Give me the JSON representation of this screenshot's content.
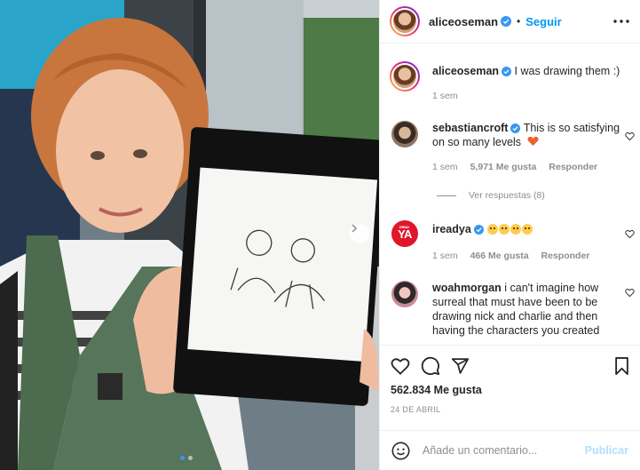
{
  "header": {
    "username": "aliceoseman",
    "separator": "•",
    "follow_label": "Seguir",
    "more_icon": "more-horizontal-icon"
  },
  "caption": {
    "username": "aliceoseman",
    "text": "I was drawing them :)",
    "time": "1 sem"
  },
  "comments": [
    {
      "username": "sebastiancroft",
      "text": "This is so satisfying on so many levels",
      "emoji": "heart-emoji",
      "time": "1 sem",
      "likes": "5,971 Me gusta",
      "reply_label": "Responder",
      "view_replies": "Ver respuestas (8)"
    },
    {
      "username": "ireadya",
      "avatar_text": "YA",
      "avatar_small_text": "I READ",
      "emojis": [
        "loudly-crying-face",
        "pleading-face",
        "pleading-face",
        "pleading-face"
      ],
      "time": "1 sem",
      "likes": "466 Me gusta",
      "reply_label": "Responder"
    },
    {
      "username": "woahmorgan",
      "text": "i can't imagine how surreal that must have been to be drawing nick and charlie and then having the characters you created"
    }
  ],
  "actions": {
    "likes": "562.834 Me gusta",
    "date": "24 DE ABRIL"
  },
  "add_comment": {
    "placeholder": "Añade un comentario...",
    "post_label": "Publicar"
  },
  "colors": {
    "link_blue": "#0095f6",
    "verified_blue": "#3897f0",
    "muted": "#8e8e8e",
    "publish_disabled": "#b2dffc"
  }
}
